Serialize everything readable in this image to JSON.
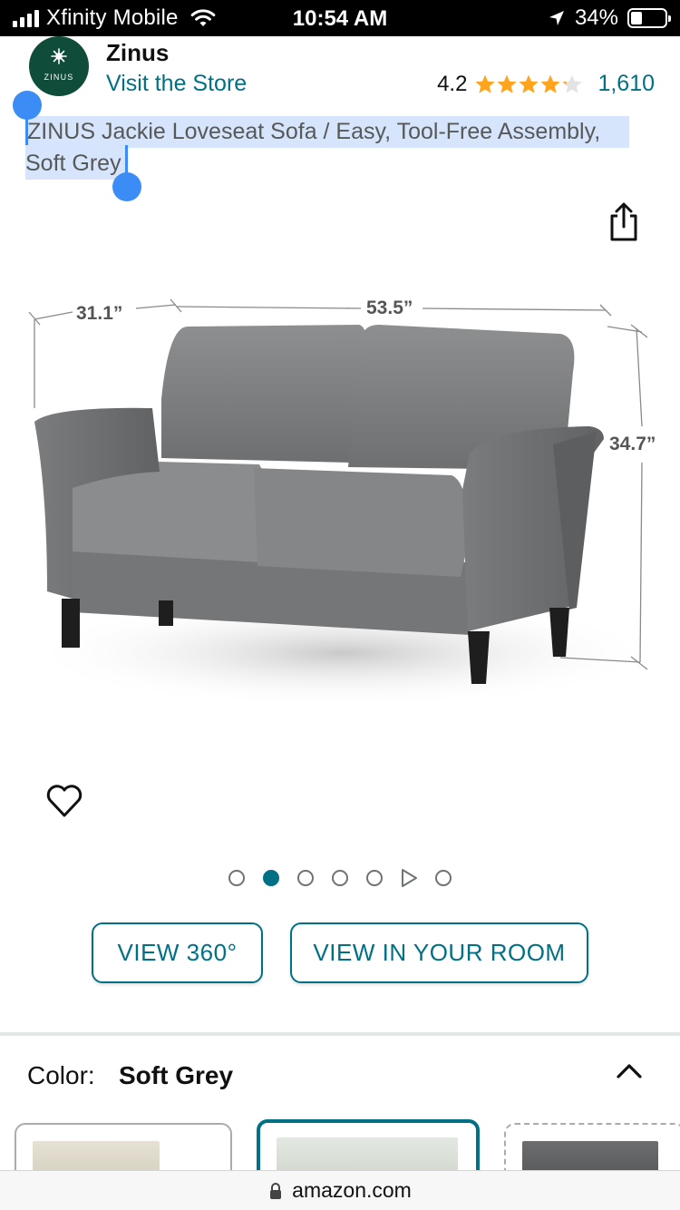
{
  "status_bar": {
    "carrier": "Xfinity Mobile",
    "time": "10:54 AM",
    "battery_percent": "34%"
  },
  "store": {
    "name": "Zinus",
    "logo_text": "ZINUS",
    "visit_store_label": "Visit the Store",
    "rating": "4.2",
    "rating_stars_value": 4.2,
    "rating_count": "1,610"
  },
  "product": {
    "title_line_1": "ZINUS Jackie Loveseat Sofa / Easy, Tool-Free Assembly,",
    "title_line_2": "Soft Grey",
    "dimensions": {
      "depth": "31.1”",
      "width": "53.5”",
      "height": "34.7”"
    }
  },
  "carousel": {
    "total_items": 7,
    "active_index": 1,
    "video_index": 5
  },
  "buttons": {
    "view_360": "VIEW 360°",
    "view_in_room": "VIEW IN YOUR ROOM"
  },
  "color_selector": {
    "label": "Color:",
    "selected": "Soft Grey"
  },
  "browser": {
    "url": "amazon.com"
  },
  "colors": {
    "link_teal": "#007185",
    "star_gold": "#ffa41c",
    "selection_blue": "#d6e5fb",
    "handle_blue": "#3b8cf5",
    "logo_green": "#0f4c3a"
  }
}
